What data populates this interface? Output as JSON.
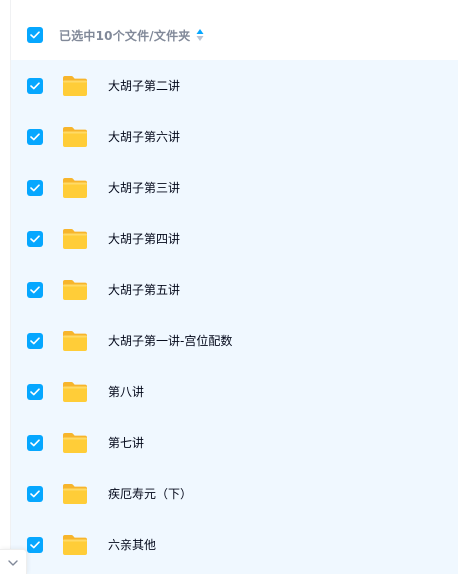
{
  "header": {
    "selection_label": "已选中10个文件/文件夹",
    "checked": true
  },
  "files": [
    {
      "name": "大胡子第二讲",
      "type": "folder",
      "checked": true
    },
    {
      "name": "大胡子第六讲",
      "type": "folder",
      "checked": true
    },
    {
      "name": "大胡子第三讲",
      "type": "folder",
      "checked": true
    },
    {
      "name": "大胡子第四讲",
      "type": "folder",
      "checked": true
    },
    {
      "name": "大胡子第五讲",
      "type": "folder",
      "checked": true
    },
    {
      "name": "大胡子第一讲-宫位配数",
      "type": "folder",
      "checked": true
    },
    {
      "name": "第八讲",
      "type": "folder",
      "checked": true
    },
    {
      "name": "第七讲",
      "type": "folder",
      "checked": true
    },
    {
      "name": "疾厄寿元（下）",
      "type": "folder",
      "checked": true
    },
    {
      "name": "六亲其他",
      "type": "folder",
      "checked": true
    }
  ],
  "colors": {
    "accent": "#06a7ff",
    "row_background": "#f0f8ff",
    "folder_body": "#ffcd38",
    "folder_tab": "#f7b52c",
    "header_text": "#818999",
    "file_text": "#03081a"
  },
  "icons": {
    "checkbox": "check-icon",
    "sort": "sort-icon",
    "folder": "folder-icon",
    "corner": "chevron-down-icon"
  }
}
